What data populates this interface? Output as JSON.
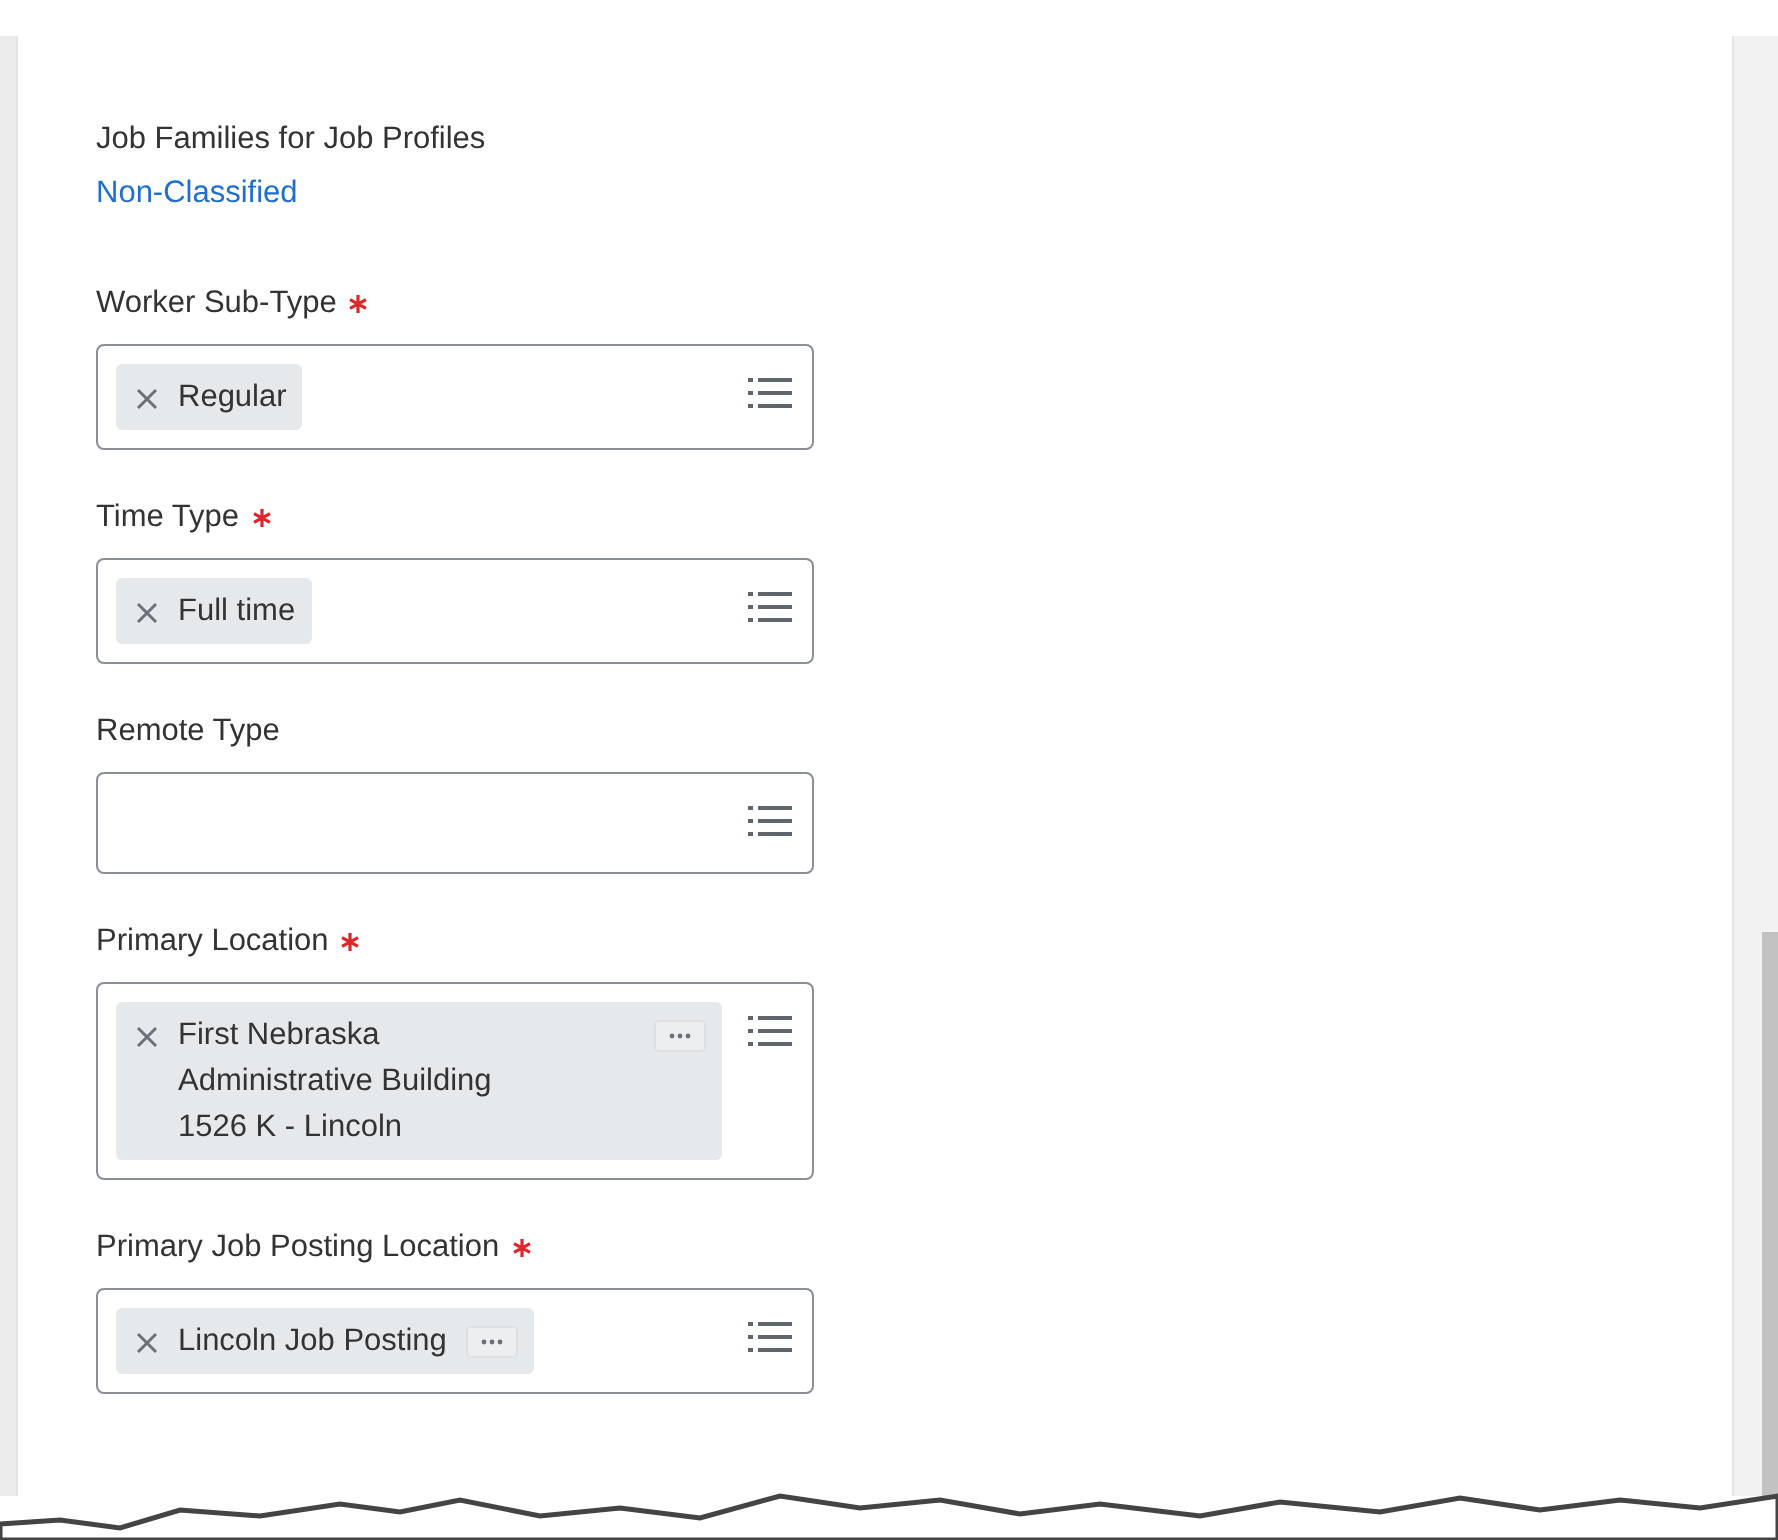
{
  "summary": {
    "label": "Job Families for Job Profiles",
    "link": "Non-Classified"
  },
  "fields": [
    {
      "label": "Worker Sub-Type",
      "required": true,
      "values": [
        {
          "lines": [
            "Regular"
          ],
          "has_menu": false
        }
      ]
    },
    {
      "label": "Time Type",
      "required": true,
      "values": [
        {
          "lines": [
            "Full time"
          ],
          "has_menu": false
        }
      ]
    },
    {
      "label": "Remote Type",
      "required": false
    },
    {
      "label": "Primary Location",
      "required": true,
      "values": [
        {
          "lines": [
            "First Nebraska",
            "Administrative Building",
            "1526 K - Lincoln"
          ],
          "has_menu": true
        }
      ]
    },
    {
      "label": "Primary Job Posting Location",
      "required": true,
      "values": [
        {
          "lines": [
            "Lincoln Job Posting"
          ],
          "has_menu": true
        }
      ]
    }
  ]
}
